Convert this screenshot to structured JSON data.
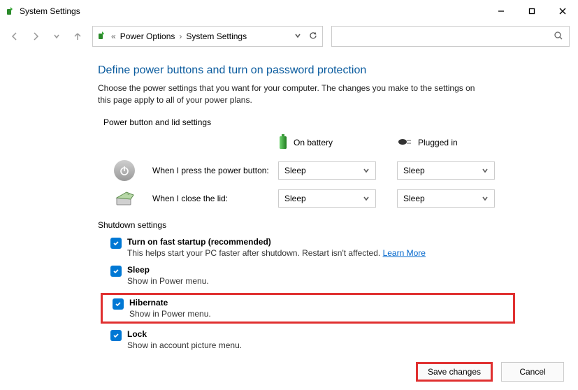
{
  "titlebar": {
    "title": "System Settings"
  },
  "breadcrumb": {
    "sep_left": "«",
    "item1": "Power Options",
    "sep": "›",
    "item2": "System Settings"
  },
  "header": {
    "title": "Define power buttons and turn on password protection",
    "description": "Choose the power settings that you want for your computer. The changes you make to the settings on this page apply to all of your power plans."
  },
  "power_section": {
    "label": "Power button and lid settings",
    "col_battery": "On battery",
    "col_plugged": "Plugged in",
    "rows": [
      {
        "label": "When I press the power button:",
        "battery": "Sleep",
        "plugged": "Sleep"
      },
      {
        "label": "When I close the lid:",
        "battery": "Sleep",
        "plugged": "Sleep"
      }
    ]
  },
  "shutdown_section": {
    "label": "Shutdown settings",
    "items": [
      {
        "title": "Turn on fast startup (recommended)",
        "desc": "This helps start your PC faster after shutdown. Restart isn't affected. ",
        "link": "Learn More"
      },
      {
        "title": "Sleep",
        "desc": "Show in Power menu."
      },
      {
        "title": "Hibernate",
        "desc": "Show in Power menu."
      },
      {
        "title": "Lock",
        "desc": "Show in account picture menu."
      }
    ]
  },
  "footer": {
    "save": "Save changes",
    "cancel": "Cancel"
  }
}
